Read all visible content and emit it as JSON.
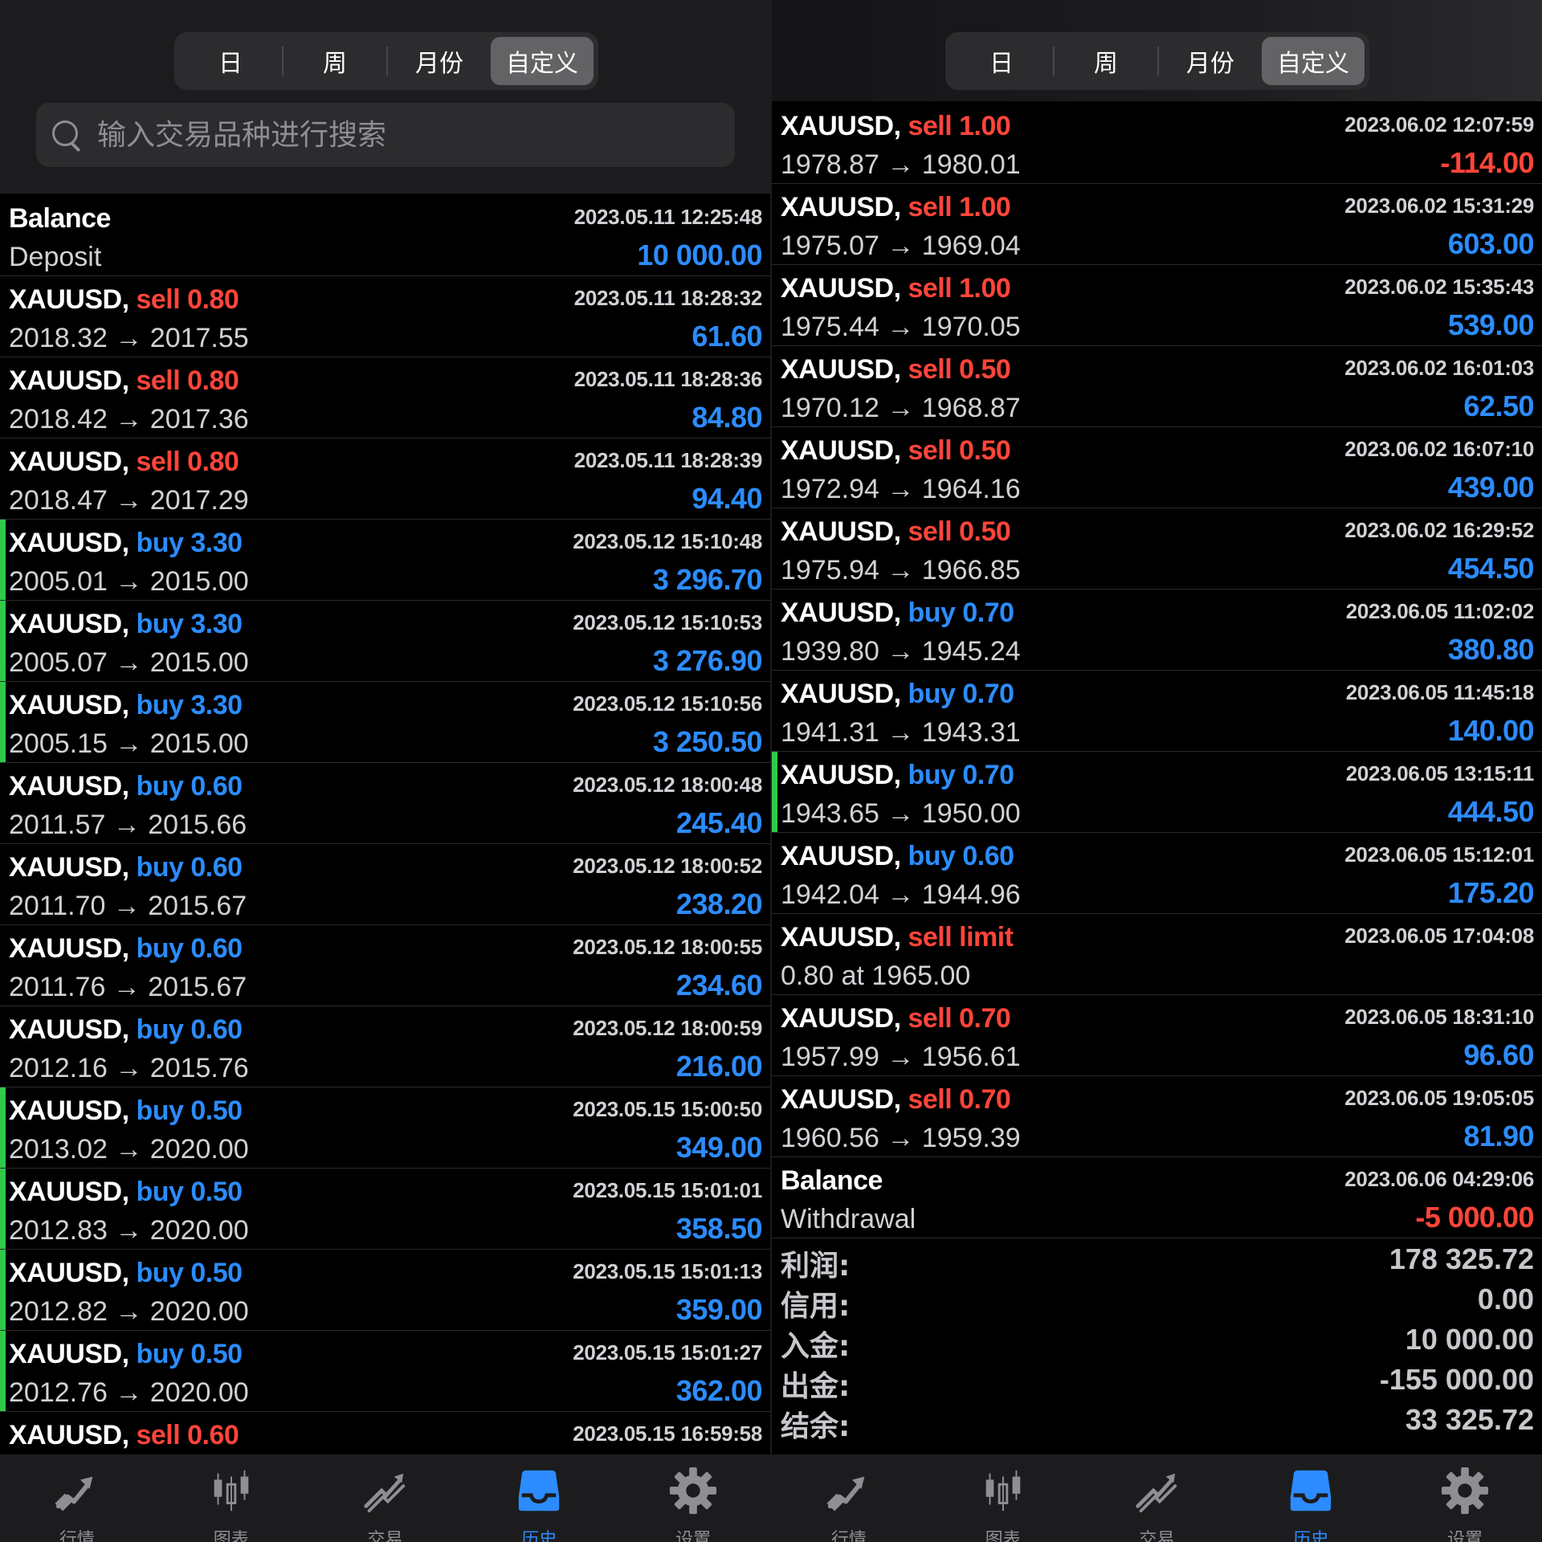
{
  "left": {
    "segments": [
      "日",
      "周",
      "月份",
      "自定义"
    ],
    "active_segment": 3,
    "search": {
      "placeholder": "输入交易品种进行搜索"
    },
    "rows": [
      {
        "symbol": "Balance",
        "action": "",
        "action_color": "",
        "sub": "Deposit",
        "time": "2023.05.11 12:25:48",
        "profit": "10 000.00",
        "profit_color": "blue",
        "marker": false
      },
      {
        "symbol": "XAUUSD",
        "action": "sell 0.80",
        "action_color": "red",
        "sub": "2018.32 → 2017.55",
        "time": "2023.05.11 18:28:32",
        "profit": "61.60",
        "profit_color": "blue",
        "marker": false
      },
      {
        "symbol": "XAUUSD",
        "action": "sell 0.80",
        "action_color": "red",
        "sub": "2018.42 → 2017.36",
        "time": "2023.05.11 18:28:36",
        "profit": "84.80",
        "profit_color": "blue",
        "marker": false
      },
      {
        "symbol": "XAUUSD",
        "action": "sell 0.80",
        "action_color": "red",
        "sub": "2018.47 → 2017.29",
        "time": "2023.05.11 18:28:39",
        "profit": "94.40",
        "profit_color": "blue",
        "marker": false
      },
      {
        "symbol": "XAUUSD",
        "action": "buy 3.30",
        "action_color": "blue",
        "sub": "2005.01 → 2015.00",
        "time": "2023.05.12 15:10:48",
        "profit": "3 296.70",
        "profit_color": "blue",
        "marker": true
      },
      {
        "symbol": "XAUUSD",
        "action": "buy 3.30",
        "action_color": "blue",
        "sub": "2005.07 → 2015.00",
        "time": "2023.05.12 15:10:53",
        "profit": "3 276.90",
        "profit_color": "blue",
        "marker": true
      },
      {
        "symbol": "XAUUSD",
        "action": "buy 3.30",
        "action_color": "blue",
        "sub": "2005.15 → 2015.00",
        "time": "2023.05.12 15:10:56",
        "profit": "3 250.50",
        "profit_color": "blue",
        "marker": true
      },
      {
        "symbol": "XAUUSD",
        "action": "buy 0.60",
        "action_color": "blue",
        "sub": "2011.57 → 2015.66",
        "time": "2023.05.12 18:00:48",
        "profit": "245.40",
        "profit_color": "blue",
        "marker": false
      },
      {
        "symbol": "XAUUSD",
        "action": "buy 0.60",
        "action_color": "blue",
        "sub": "2011.70 → 2015.67",
        "time": "2023.05.12 18:00:52",
        "profit": "238.20",
        "profit_color": "blue",
        "marker": false
      },
      {
        "symbol": "XAUUSD",
        "action": "buy 0.60",
        "action_color": "blue",
        "sub": "2011.76 → 2015.67",
        "time": "2023.05.12 18:00:55",
        "profit": "234.60",
        "profit_color": "blue",
        "marker": false
      },
      {
        "symbol": "XAUUSD",
        "action": "buy 0.60",
        "action_color": "blue",
        "sub": "2012.16 → 2015.76",
        "time": "2023.05.12 18:00:59",
        "profit": "216.00",
        "profit_color": "blue",
        "marker": false
      },
      {
        "symbol": "XAUUSD",
        "action": "buy 0.50",
        "action_color": "blue",
        "sub": "2013.02 → 2020.00",
        "time": "2023.05.15 15:00:50",
        "profit": "349.00",
        "profit_color": "blue",
        "marker": true
      },
      {
        "symbol": "XAUUSD",
        "action": "buy 0.50",
        "action_color": "blue",
        "sub": "2012.83 → 2020.00",
        "time": "2023.05.15 15:01:01",
        "profit": "358.50",
        "profit_color": "blue",
        "marker": true
      },
      {
        "symbol": "XAUUSD",
        "action": "buy 0.50",
        "action_color": "blue",
        "sub": "2012.82 → 2020.00",
        "time": "2023.05.15 15:01:13",
        "profit": "359.00",
        "profit_color": "blue",
        "marker": true
      },
      {
        "symbol": "XAUUSD",
        "action": "buy 0.50",
        "action_color": "blue",
        "sub": "2012.76 → 2020.00",
        "time": "2023.05.15 15:01:27",
        "profit": "362.00",
        "profit_color": "blue",
        "marker": true
      },
      {
        "symbol": "XAUUSD",
        "action": "sell 0.60",
        "action_color": "red",
        "sub": "",
        "time": "2023.05.15 16:59:58",
        "profit": "",
        "profit_color": "blue",
        "marker": false
      }
    ]
  },
  "right": {
    "segments": [
      "日",
      "周",
      "月份",
      "自定义"
    ],
    "active_segment": 3,
    "rows": [
      {
        "symbol": "XAUUSD",
        "action": "sell 1.00",
        "action_color": "red",
        "sub": "1978.87 → 1980.01",
        "time": "2023.06.02 12:07:59",
        "profit": "-114.00",
        "profit_color": "red",
        "marker": false
      },
      {
        "symbol": "XAUUSD",
        "action": "sell 1.00",
        "action_color": "red",
        "sub": "1975.07 → 1969.04",
        "time": "2023.06.02 15:31:29",
        "profit": "603.00",
        "profit_color": "blue",
        "marker": false
      },
      {
        "symbol": "XAUUSD",
        "action": "sell 1.00",
        "action_color": "red",
        "sub": "1975.44 → 1970.05",
        "time": "2023.06.02 15:35:43",
        "profit": "539.00",
        "profit_color": "blue",
        "marker": false
      },
      {
        "symbol": "XAUUSD",
        "action": "sell 0.50",
        "action_color": "red",
        "sub": "1970.12 → 1968.87",
        "time": "2023.06.02 16:01:03",
        "profit": "62.50",
        "profit_color": "blue",
        "marker": false
      },
      {
        "symbol": "XAUUSD",
        "action": "sell 0.50",
        "action_color": "red",
        "sub": "1972.94 → 1964.16",
        "time": "2023.06.02 16:07:10",
        "profit": "439.00",
        "profit_color": "blue",
        "marker": false
      },
      {
        "symbol": "XAUUSD",
        "action": "sell 0.50",
        "action_color": "red",
        "sub": "1975.94 → 1966.85",
        "time": "2023.06.02 16:29:52",
        "profit": "454.50",
        "profit_color": "blue",
        "marker": false
      },
      {
        "symbol": "XAUUSD",
        "action": "buy 0.70",
        "action_color": "blue",
        "sub": "1939.80 → 1945.24",
        "time": "2023.06.05 11:02:02",
        "profit": "380.80",
        "profit_color": "blue",
        "marker": false
      },
      {
        "symbol": "XAUUSD",
        "action": "buy 0.70",
        "action_color": "blue",
        "sub": "1941.31 → 1943.31",
        "time": "2023.06.05 11:45:18",
        "profit": "140.00",
        "profit_color": "blue",
        "marker": false
      },
      {
        "symbol": "XAUUSD",
        "action": "buy 0.70",
        "action_color": "blue",
        "sub": "1943.65 → 1950.00",
        "time": "2023.06.05 13:15:11",
        "profit": "444.50",
        "profit_color": "blue",
        "marker": true
      },
      {
        "symbol": "XAUUSD",
        "action": "buy 0.60",
        "action_color": "blue",
        "sub": "1942.04 → 1944.96",
        "time": "2023.06.05 15:12:01",
        "profit": "175.20",
        "profit_color": "blue",
        "marker": false
      },
      {
        "symbol": "XAUUSD",
        "action": "sell limit",
        "action_color": "red",
        "sub": "0.80 at 1965.00",
        "time": "2023.06.05 17:04:08",
        "profit": "",
        "profit_color": "blue",
        "marker": false
      },
      {
        "symbol": "XAUUSD",
        "action": "sell 0.70",
        "action_color": "red",
        "sub": "1957.99 → 1956.61",
        "time": "2023.06.05 18:31:10",
        "profit": "96.60",
        "profit_color": "blue",
        "marker": false
      },
      {
        "symbol": "XAUUSD",
        "action": "sell 0.70",
        "action_color": "red",
        "sub": "1960.56 → 1959.39",
        "time": "2023.06.05 19:05:05",
        "profit": "81.90",
        "profit_color": "blue",
        "marker": false
      },
      {
        "symbol": "Balance",
        "action": "",
        "action_color": "",
        "sub": "Withdrawal",
        "time": "2023.06.06 04:29:06",
        "profit": "-5 000.00",
        "profit_color": "red",
        "marker": false
      }
    ],
    "summary": [
      {
        "label": "利润:",
        "value": "178 325.72"
      },
      {
        "label": "信用:",
        "value": "0.00"
      },
      {
        "label": "入金:",
        "value": "10 000.00"
      },
      {
        "label": "出金:",
        "value": "-155 000.00"
      },
      {
        "label": "结余:",
        "value": "33 325.72"
      }
    ]
  },
  "tabs": [
    {
      "label": "行情",
      "icon": "quotes-icon"
    },
    {
      "label": "图表",
      "icon": "chart-icon"
    },
    {
      "label": "交易",
      "icon": "trade-icon"
    },
    {
      "label": "历史",
      "icon": "history-icon"
    },
    {
      "label": "设置",
      "icon": "settings-icon"
    }
  ],
  "active_tab": 3,
  "colors": {
    "red": "#ff453a",
    "blue": "#2c8cff",
    "green_marker": "#30c94a",
    "background": "#000000"
  }
}
